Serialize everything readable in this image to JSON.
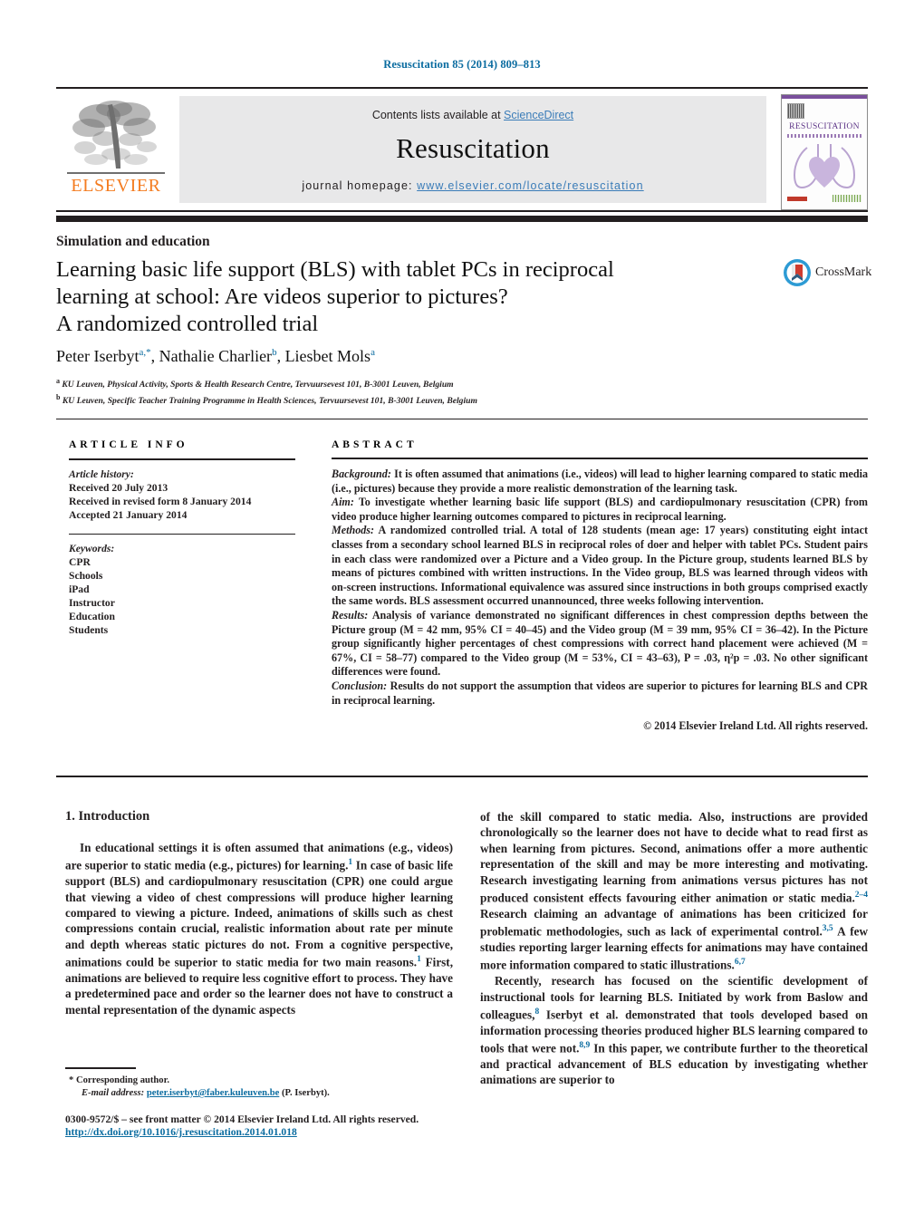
{
  "running_head": "Resuscitation 85 (2014) 809–813",
  "masthead": {
    "contents_prefix": "Contents lists available at ",
    "sciencedirect": "ScienceDirect",
    "journal_name": "Resuscitation",
    "homepage_label": "journal homepage: ",
    "homepage_url": "www.elsevier.com/locate/resuscitation",
    "elsevier_wordmark": "ELSEVIER",
    "cover_title": "RESUSCITATION"
  },
  "article": {
    "section_label": "Simulation and education",
    "title_line1": "Learning basic life support (BLS) with tablet PCs in reciprocal",
    "title_line2": "learning at school: Are videos superior to pictures?",
    "title_line3": "A randomized controlled trial",
    "authors": "Peter Iserbyt",
    "author2": "Nathalie Charlier",
    "author3": "Liesbet Mols",
    "affiliation_a": "KU Leuven, Physical Activity, Sports & Health Research Centre, Tervuursevest 101, B-3001 Leuven, Belgium",
    "affiliation_b": "KU Leuven, Specific Teacher Training Programme in Health Sciences, Tervuursevest 101, B-3001 Leuven, Belgium",
    "crossmark_label": "CrossMark"
  },
  "info": {
    "heading": "ARTICLE INFO",
    "history_label": "Article history:",
    "history": [
      "Received 20 July 2013",
      "Received in revised form 8 January 2014",
      "Accepted 21 January 2014"
    ],
    "keywords_label": "Keywords:",
    "keywords": [
      "CPR",
      "Schools",
      "iPad",
      "Instructor",
      "Education",
      "Students"
    ]
  },
  "abstract": {
    "heading": "ABSTRACT",
    "background_label": "Background:",
    "background": " It is often assumed that animations (i.e., videos) will lead to higher learning compared to static media (i.e., pictures) because they provide a more realistic demonstration of the learning task.",
    "aim_label": "Aim:",
    "aim": " To investigate whether learning basic life support (BLS) and cardiopulmonary resuscitation (CPR) from video produce higher learning outcomes compared to pictures in reciprocal learning.",
    "methods_label": "Methods:",
    "methods": " A randomized controlled trial. A total of 128 students (mean age: 17 years) constituting eight intact classes from a secondary school learned BLS in reciprocal roles of doer and helper with tablet PCs. Student pairs in each class were randomized over a Picture and a Video group. In the Picture group, students learned BLS by means of pictures combined with written instructions. In the Video group, BLS was learned through videos with on-screen instructions. Informational equivalence was assured since instructions in both groups comprised exactly the same words. BLS assessment occurred unannounced, three weeks following intervention.",
    "results_label": "Results:",
    "results": " Analysis of variance demonstrated no significant differences in chest compression depths between the Picture group (M = 42 mm, 95% CI = 40–45) and the Video group (M = 39 mm, 95% CI = 36–42). In the Picture group significantly higher percentages of chest compressions with correct hand placement were achieved (M = 67%, CI = 58–77) compared to the Video group (M = 53%, CI = 43–63), P = .03, η²p = .03. No other significant differences were found.",
    "conclusion_label": "Conclusion:",
    "conclusion": " Results do not support the assumption that videos are superior to pictures for learning BLS and CPR in reciprocal learning.",
    "copyright": "© 2014 Elsevier Ireland Ltd. All rights reserved."
  },
  "body": {
    "intro_heading": "1.  Introduction",
    "left_p1_a": "In educational settings it is often assumed that animations (e.g., videos) are superior to static media (e.g., pictures) for learning.",
    "left_p1_ref1": "1",
    "left_p1_b": " In case of basic life support (BLS) and cardiopulmonary resuscitation (CPR) one could argue that viewing a video of chest compressions will produce higher learning compared to viewing a picture. Indeed, animations of skills such as chest compressions contain crucial, realistic information about rate per minute and depth whereas static pictures do not. From a cognitive perspective, animations could be superior to static media for two main reasons.",
    "left_p1_ref2": "1",
    "left_p1_c": " First, animations are believed to require less cognitive effort to process. They have a predetermined pace and order so the learner does not have to construct a mental representation of the dynamic aspects",
    "right_p1_a": "of the skill compared to static media. Also, instructions are provided chronologically so the learner does not have to decide what to read first as when learning from pictures. Second, animations offer a more authentic representation of the skill and may be more interesting and motivating. Research investigating learning from animations versus pictures has not produced consistent effects favouring either animation or static media.",
    "right_p1_ref1": "2–4",
    "right_p1_b": " Research claiming an advantage of animations has been criticized for problematic methodologies, such as lack of experimental control.",
    "right_p1_ref2": "3,5",
    "right_p1_c": " A few studies reporting larger learning effects for animations may have contained more information compared to static illustrations.",
    "right_p1_ref3": "6,7",
    "right_p2_a": "Recently, research has focused on the scientific development of instructional tools for learning BLS. Initiated by work from Baslow and colleagues,",
    "right_p2_ref1": "8",
    "right_p2_b": " Iserbyt et al. demonstrated that tools developed based on information processing theories produced higher BLS learning compared to tools that were not.",
    "right_p2_ref2": "8,9",
    "right_p2_c": " In this paper, we contribute further to the theoretical and practical advancement of BLS education by investigating whether animations are superior to"
  },
  "footer": {
    "corresponding_marker": "*",
    "corresponding_label": "Corresponding author.",
    "email_label": "E-mail address:",
    "email": "peter.iserbyt@faber.kuleuven.be",
    "email_suffix": "(P. Iserbyt).",
    "issn_line": "0300-9572/$ – see front matter © 2014 Elsevier Ireland Ltd. All rights reserved.",
    "doi": "http://dx.doi.org/10.1016/j.resuscitation.2014.01.018"
  },
  "colors": {
    "link": "#0b6ca0",
    "sciencedirect": "#3a7cb8",
    "elsevier_orange": "#f47c20",
    "rule": "#231f20",
    "mast_bg": "#e8e8e9",
    "cover_purple": "#7a4f9c"
  }
}
